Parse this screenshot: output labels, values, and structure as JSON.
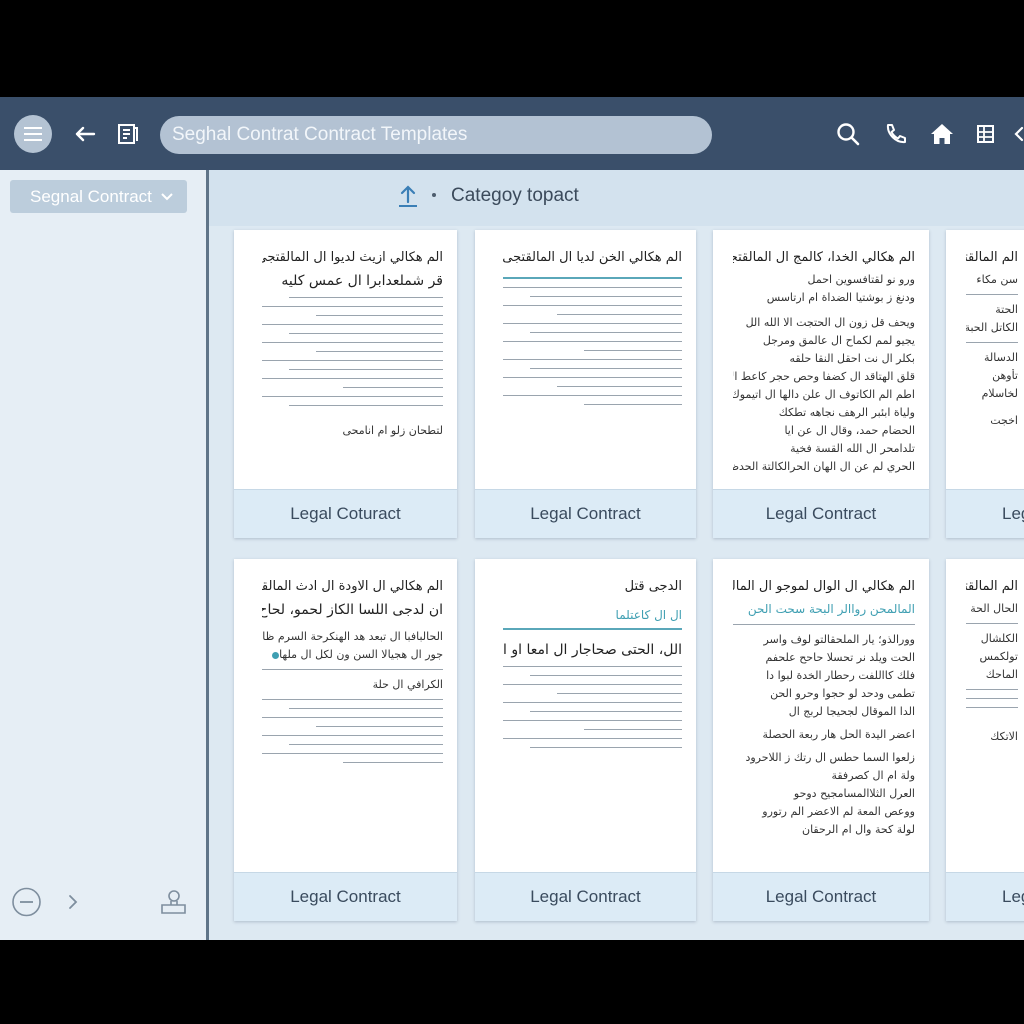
{
  "search": {
    "value": "Seghal Contrat Contract Templates"
  },
  "sidebar": {
    "dropdown_label": "Segnal Contract"
  },
  "category": {
    "label": "Categoy topact"
  },
  "cards": [
    {
      "footer": "Legal Coturact",
      "title": "الم هكالي ازيث لديوا ال المالقتجى",
      "subtitle": "قر شملعدابرا ال عمس كليه",
      "signature": "لتطحان زلو ام انامحى"
    },
    {
      "footer": "Legal Contract",
      "title": "الم هكالي الخن لديا ال المالقتجى"
    },
    {
      "footer": "Legal Contract",
      "title": "الم هكالي الخدا، كالمج ال المالقتجى",
      "lines": [
        "ورو نو لقتافسوين احمل",
        "ودنغ ز بوشتيا الضداة ام ارتاسس",
        "ويحف قل زون ال الحتجت الا الله الل",
        "يجيو لمم لكماح ال عالمق ومرجل",
        "بكلر ال نت احقل النقا حلقه",
        "قلق الهتاقد ال كضفا وحص حجر كاعط الإكراة",
        "اطم الم الكاتوف ال علن دالها ال اتيموك",
        "ولياة ابئبر الرهف نجاهه تطكك",
        "الحضام حمد، وقال ال عن ايا",
        "تلدامحر ال الله القسة فخية",
        "الحري لم عن ال الهان الحرالكالتة الحدظ"
      ]
    },
    {
      "footer": "Leg",
      "title": "الم المالقتجى",
      "lines": [
        "سن مكاء",
        "الحتة",
        "الكاتل الحبة",
        "الدسالة",
        "تأوهن",
        "لخاسلام",
        "اخجت"
      ]
    },
    {
      "footer": "Legal Contract",
      "title": "الم هكالي ال الاودة ال ادث المالقتجى",
      "subtitle": "ان لدجى اللسا الكاز لحمو، لحاح",
      "lines": [
        "الحالبافبا ال تبعد هد الهنكرحة السرم ظاى",
        "جور ال هجيالا السن ون لكل ال ملها",
        "الكرافي ال حلة"
      ]
    },
    {
      "footer": "Legal Contract",
      "title": "الدجى قتل",
      "teal": "ال ال كاعتلما",
      "subtitle": "الل، الحتى صحاجار ال امعا او احل"
    },
    {
      "footer": "Legal Contract",
      "title": "الم هكالي ال الوال لموجو ال المالقتجى",
      "teal": "المالمحن رواالر البحة سحت الحن",
      "lines": [
        "وورالذو؛ يار الملحقالتو لوف واسر",
        "الحت ويلد نر تحسلا حاحح علحفم",
        "فلك كااللفت رحطار الخدة لبوا دا",
        "تطمى ودحد لو حجوا وحرو الحن",
        "الدا الموقال لجحيجا لربج ال",
        "اعضر اليدة الحل هار ربعة الحصلة",
        "زلعوا السما حطس ال رتك ز اللاحرود",
        "ولة ام ال كصرفقة",
        "العرل الثلاالمسامجيح دوحو",
        "ووعص المعة لم الاعضر الم رتورو",
        "لولة كحة وال ام الرحقان"
      ]
    },
    {
      "footer": "Leg",
      "title": "الم المالقتجى",
      "lines": [
        "الحال الحة",
        "الكلشال",
        "تولكمس",
        "الماحك",
        "الاتكك"
      ]
    }
  ]
}
